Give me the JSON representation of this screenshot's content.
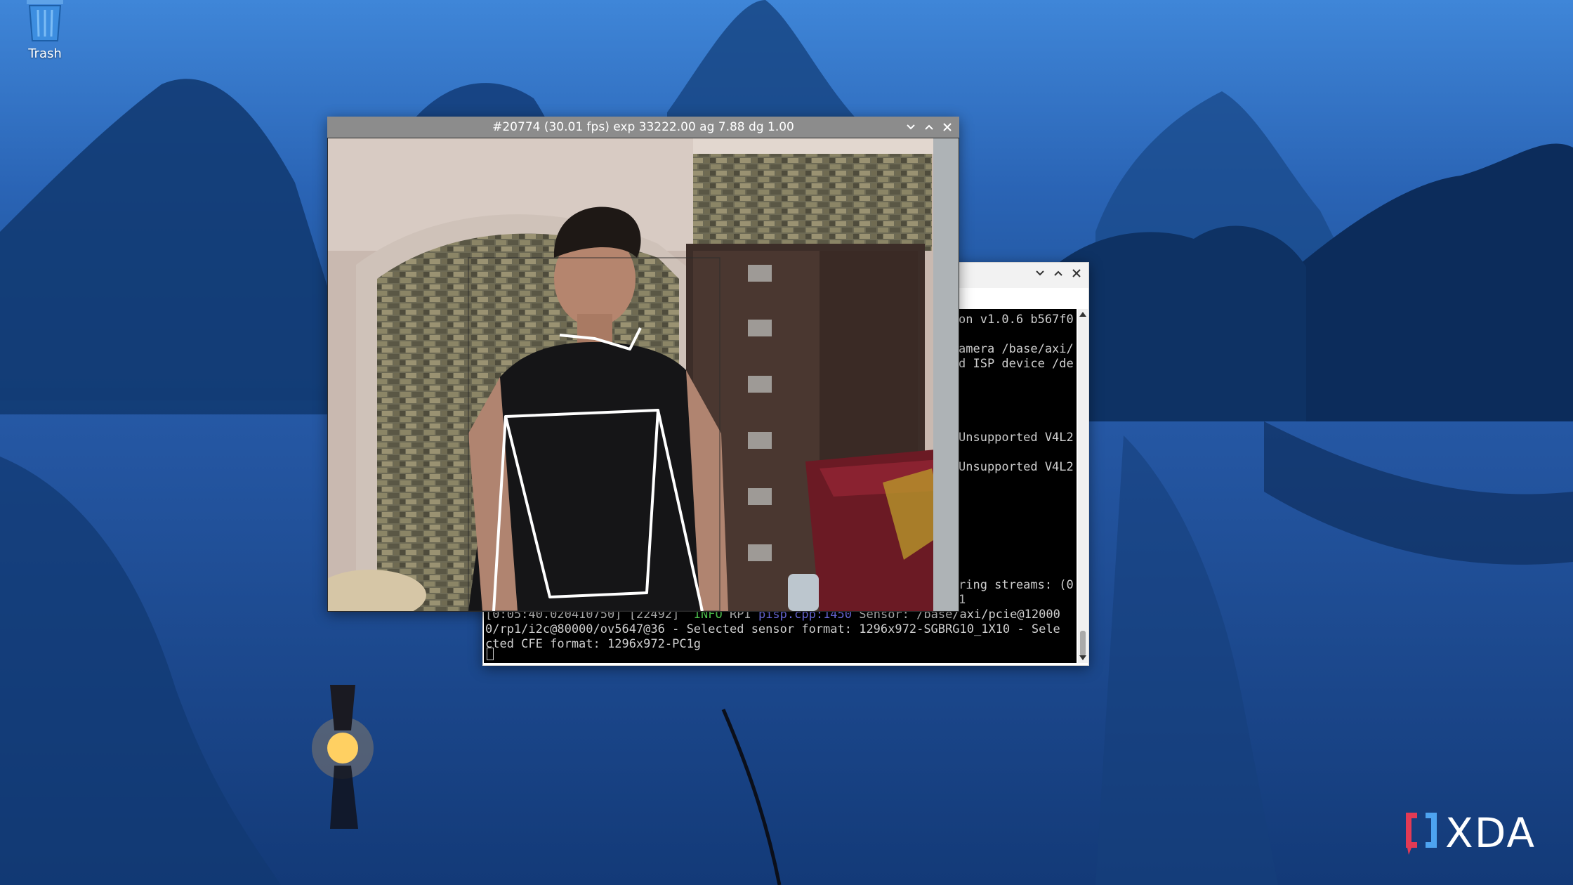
{
  "desktop": {
    "icons": [
      {
        "label": "Trash",
        "icon": "trash-icon"
      }
    ]
  },
  "camera_window": {
    "title": "#20774 (30.01 fps) exp 33222.00 ag 7.88 dg 1.00",
    "controls": [
      "minimize-icon",
      "maximize-icon",
      "close-icon"
    ]
  },
  "terminal_window": {
    "controls": [
      "minimize-icon",
      "maximize-icon",
      "close-icon"
    ],
    "visible_fragments": [
      "on v1.0.6 b567f0",
      "amera /base/axi/",
      "d ISP device /de",
      "Unsupported V4L2",
      "Unsupported V4L2",
      "ring streams: (0",
      "1"
    ],
    "bottom_lines": {
      "line1_prefix": "[0:05:40.020410750] [22492]  ",
      "line1_level": "INFO",
      "line1_mid": " RPI ",
      "line1_component": "pisp.cpp:1450",
      "line1_rest": " Sensor: /base/axi/pcie@12000",
      "line2": "0/rp1/i2c@80000/ov5647@36 - Selected sensor format: 1296x972-SGBRG10_1X10 - Sele",
      "line3": "cted CFE format: 1296x972-PC1g"
    }
  },
  "colors": {
    "terminal_bg": "#000000",
    "terminal_text": "#cfcfcf",
    "camera_titlebar": "#8c8c8c",
    "pose_lines": "#ffffff"
  },
  "watermark": {
    "text": "XDA"
  }
}
